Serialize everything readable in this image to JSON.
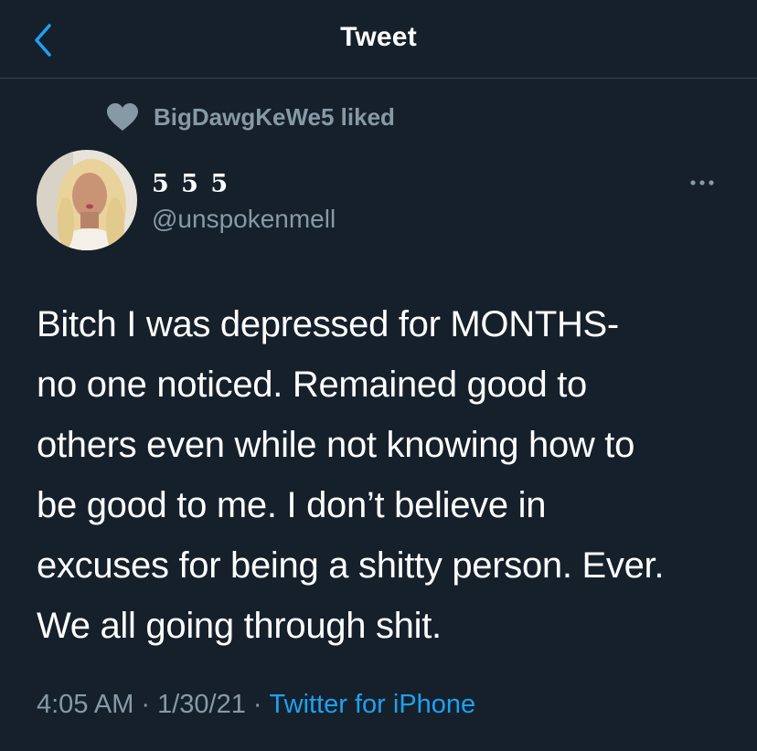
{
  "header": {
    "title": "Tweet",
    "back_icon": "chevron-left-icon"
  },
  "social_context": {
    "icon": "heart-icon",
    "text": "BigDawgKeWe5 liked"
  },
  "author": {
    "display_name": "5 5 5",
    "handle": "@unspokenmell"
  },
  "tweet": {
    "lines": [
      "Bitch I was depressed for MONTHS-",
      "no one noticed. Remained good to",
      "others even while not knowing how to",
      "be good to me. I don’t believe in",
      "excuses for being a shitty person. Ever.",
      "We all going through shit."
    ]
  },
  "meta": {
    "time": "4:05 AM",
    "date": "1/30/21",
    "separator": "·",
    "source": "Twitter for iPhone"
  },
  "colors": {
    "background": "#15202b",
    "text": "#ffffff",
    "secondary_text": "#8899a6",
    "accent": "#1da1f2",
    "divider": "#38444d"
  }
}
